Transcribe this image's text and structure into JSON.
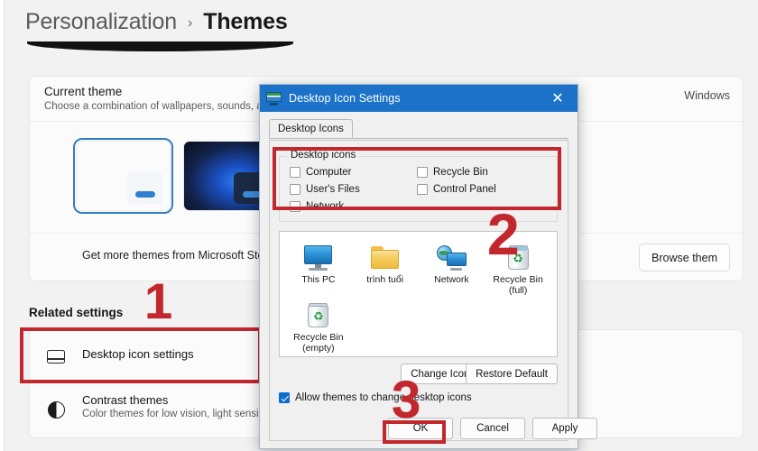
{
  "breadcrumb": {
    "parent": "Personalization",
    "separator": "›",
    "current": "Themes"
  },
  "current_theme_card": {
    "title": "Current theme",
    "subtitle": "Choose a combination of wallpapers, sounds, and",
    "right_label": "Windows",
    "thumbnails": [
      {
        "name": "windows-light-bloom",
        "selected": true
      },
      {
        "name": "windows-dark-bloom",
        "selected": false
      },
      {
        "name": "glow-seascape",
        "selected": false
      },
      {
        "name": "flow-grey-flower",
        "selected": false
      }
    ],
    "footer_text": "Get more themes from Microsoft Stor",
    "browse_button": "Browse them"
  },
  "related_settings": {
    "heading": "Related settings",
    "items": [
      {
        "icon": "monitor-icon",
        "label": "Desktop icon settings",
        "description": ""
      },
      {
        "icon": "contrast-icon",
        "label": "Contrast themes",
        "description": "Color themes for low vision, light sensitivit"
      }
    ]
  },
  "annotations": {
    "step1": "1",
    "step2": "2",
    "step3": "3",
    "color": "#c1272d"
  },
  "dialog": {
    "title": "Desktop Icon Settings",
    "close_label": "✕",
    "tab": "Desktop Icons",
    "group_label": "Desktop icons",
    "checkboxes": [
      {
        "label": "Computer",
        "checked": false
      },
      {
        "label": "User's Files",
        "checked": false
      },
      {
        "label": "Network",
        "checked": false
      },
      {
        "label": "Recycle Bin",
        "checked": false
      },
      {
        "label": "Control Panel",
        "checked": false
      }
    ],
    "icon_previews": [
      {
        "icon": "this-pc-icon",
        "caption": "This PC"
      },
      {
        "icon": "folder-icon",
        "caption": "trình tuổi"
      },
      {
        "icon": "network-icon",
        "caption": "Network"
      },
      {
        "icon": "recycle-bin-full-icon",
        "caption": "Recycle Bin\n(full)"
      },
      {
        "icon": "recycle-bin-empty-icon",
        "caption": "Recycle Bin\n(empty)"
      }
    ],
    "change_icon_button": "Change Icon...",
    "restore_default_button": "Restore Default",
    "allow_themes": {
      "label": "Allow themes to change desktop icons",
      "checked": true
    },
    "footer_buttons": {
      "ok": "OK",
      "cancel": "Cancel",
      "apply": "Apply"
    },
    "accent_color": "#1b72c8"
  }
}
